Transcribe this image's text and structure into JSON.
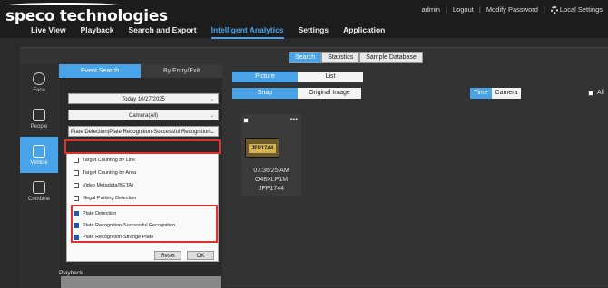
{
  "app": {
    "logo": "speco technologies",
    "toplinks": {
      "user": "admin",
      "logout": "Logout",
      "modify": "Modify Password",
      "local": "Local Settings"
    },
    "nav": [
      "Live View",
      "Playback",
      "Search and Export",
      "Intelligent Analytics",
      "Settings",
      "Application"
    ],
    "nav_active": "Intelligent Analytics"
  },
  "subtabs": [
    "Search",
    "Statistics",
    "Sample Database"
  ],
  "leftnav": [
    {
      "label": "Face",
      "icon": "face-icon"
    },
    {
      "label": "People",
      "icon": "people-icon"
    },
    {
      "label": "Vehicle",
      "icon": "vehicle-icon"
    },
    {
      "label": "Combine",
      "icon": "combine-icon"
    }
  ],
  "panel": {
    "tabs": [
      "Event Search",
      "By Entry/Exit"
    ],
    "date": "Today 10/27/2025",
    "camera": "Camera(All)",
    "event_type": "Plate Detection|Plate Recognition-Successful Recognition...",
    "options": [
      {
        "label": "Target Counting by Line",
        "checked": false
      },
      {
        "label": "Target Counting by Area",
        "checked": false
      },
      {
        "label": "Video Metadata(BETA)",
        "checked": false
      },
      {
        "label": "Illegal Parking Detection",
        "checked": false
      },
      {
        "label": "Plate Detection",
        "checked": true
      },
      {
        "label": "Plate Recognition-Successful Recognition",
        "checked": true
      },
      {
        "label": "Plate Recognition-Strange Plate",
        "checked": true
      }
    ],
    "reset": "Reset",
    "ok": "OK",
    "playback": "Playback"
  },
  "right": {
    "view_tabs": [
      "Picture",
      "List"
    ],
    "image_tabs": [
      "Snap",
      "Original Image"
    ],
    "sort_tabs": [
      "Time",
      "Camera"
    ],
    "all_label": "All",
    "card": {
      "time": "07:36:25 AM",
      "camera": "O48XLP1M",
      "plate": "JFP1744"
    }
  }
}
